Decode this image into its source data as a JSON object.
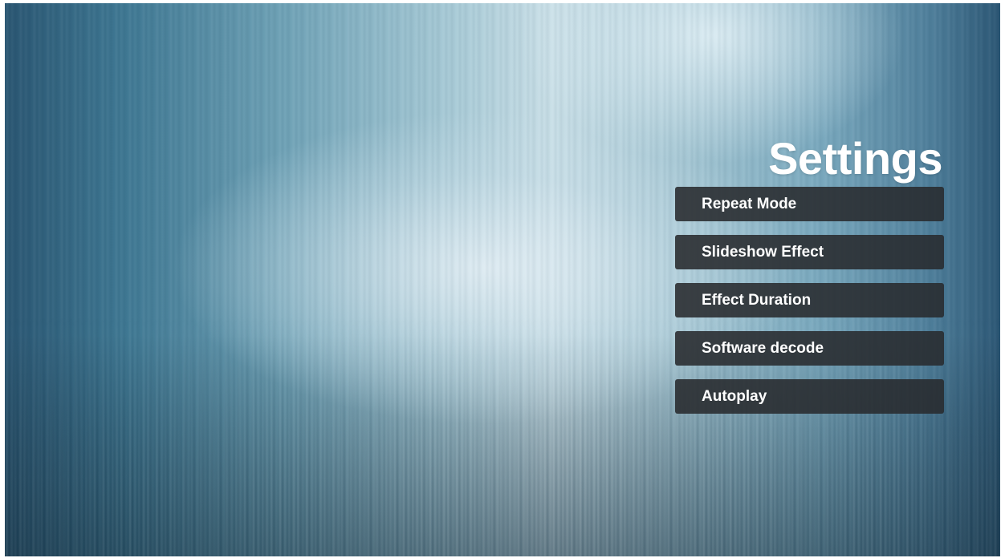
{
  "page": {
    "title": "Settings"
  },
  "menu": {
    "items": [
      {
        "label": "Repeat Mode"
      },
      {
        "label": "Slideshow Effect"
      },
      {
        "label": "Effect Duration"
      },
      {
        "label": "Software decode"
      },
      {
        "label": "Autoplay"
      }
    ]
  },
  "colors": {
    "item_background": "#2a2c30",
    "text": "#ffffff",
    "background_light": "#c9dfe7",
    "background_dark": "#2a5672"
  }
}
